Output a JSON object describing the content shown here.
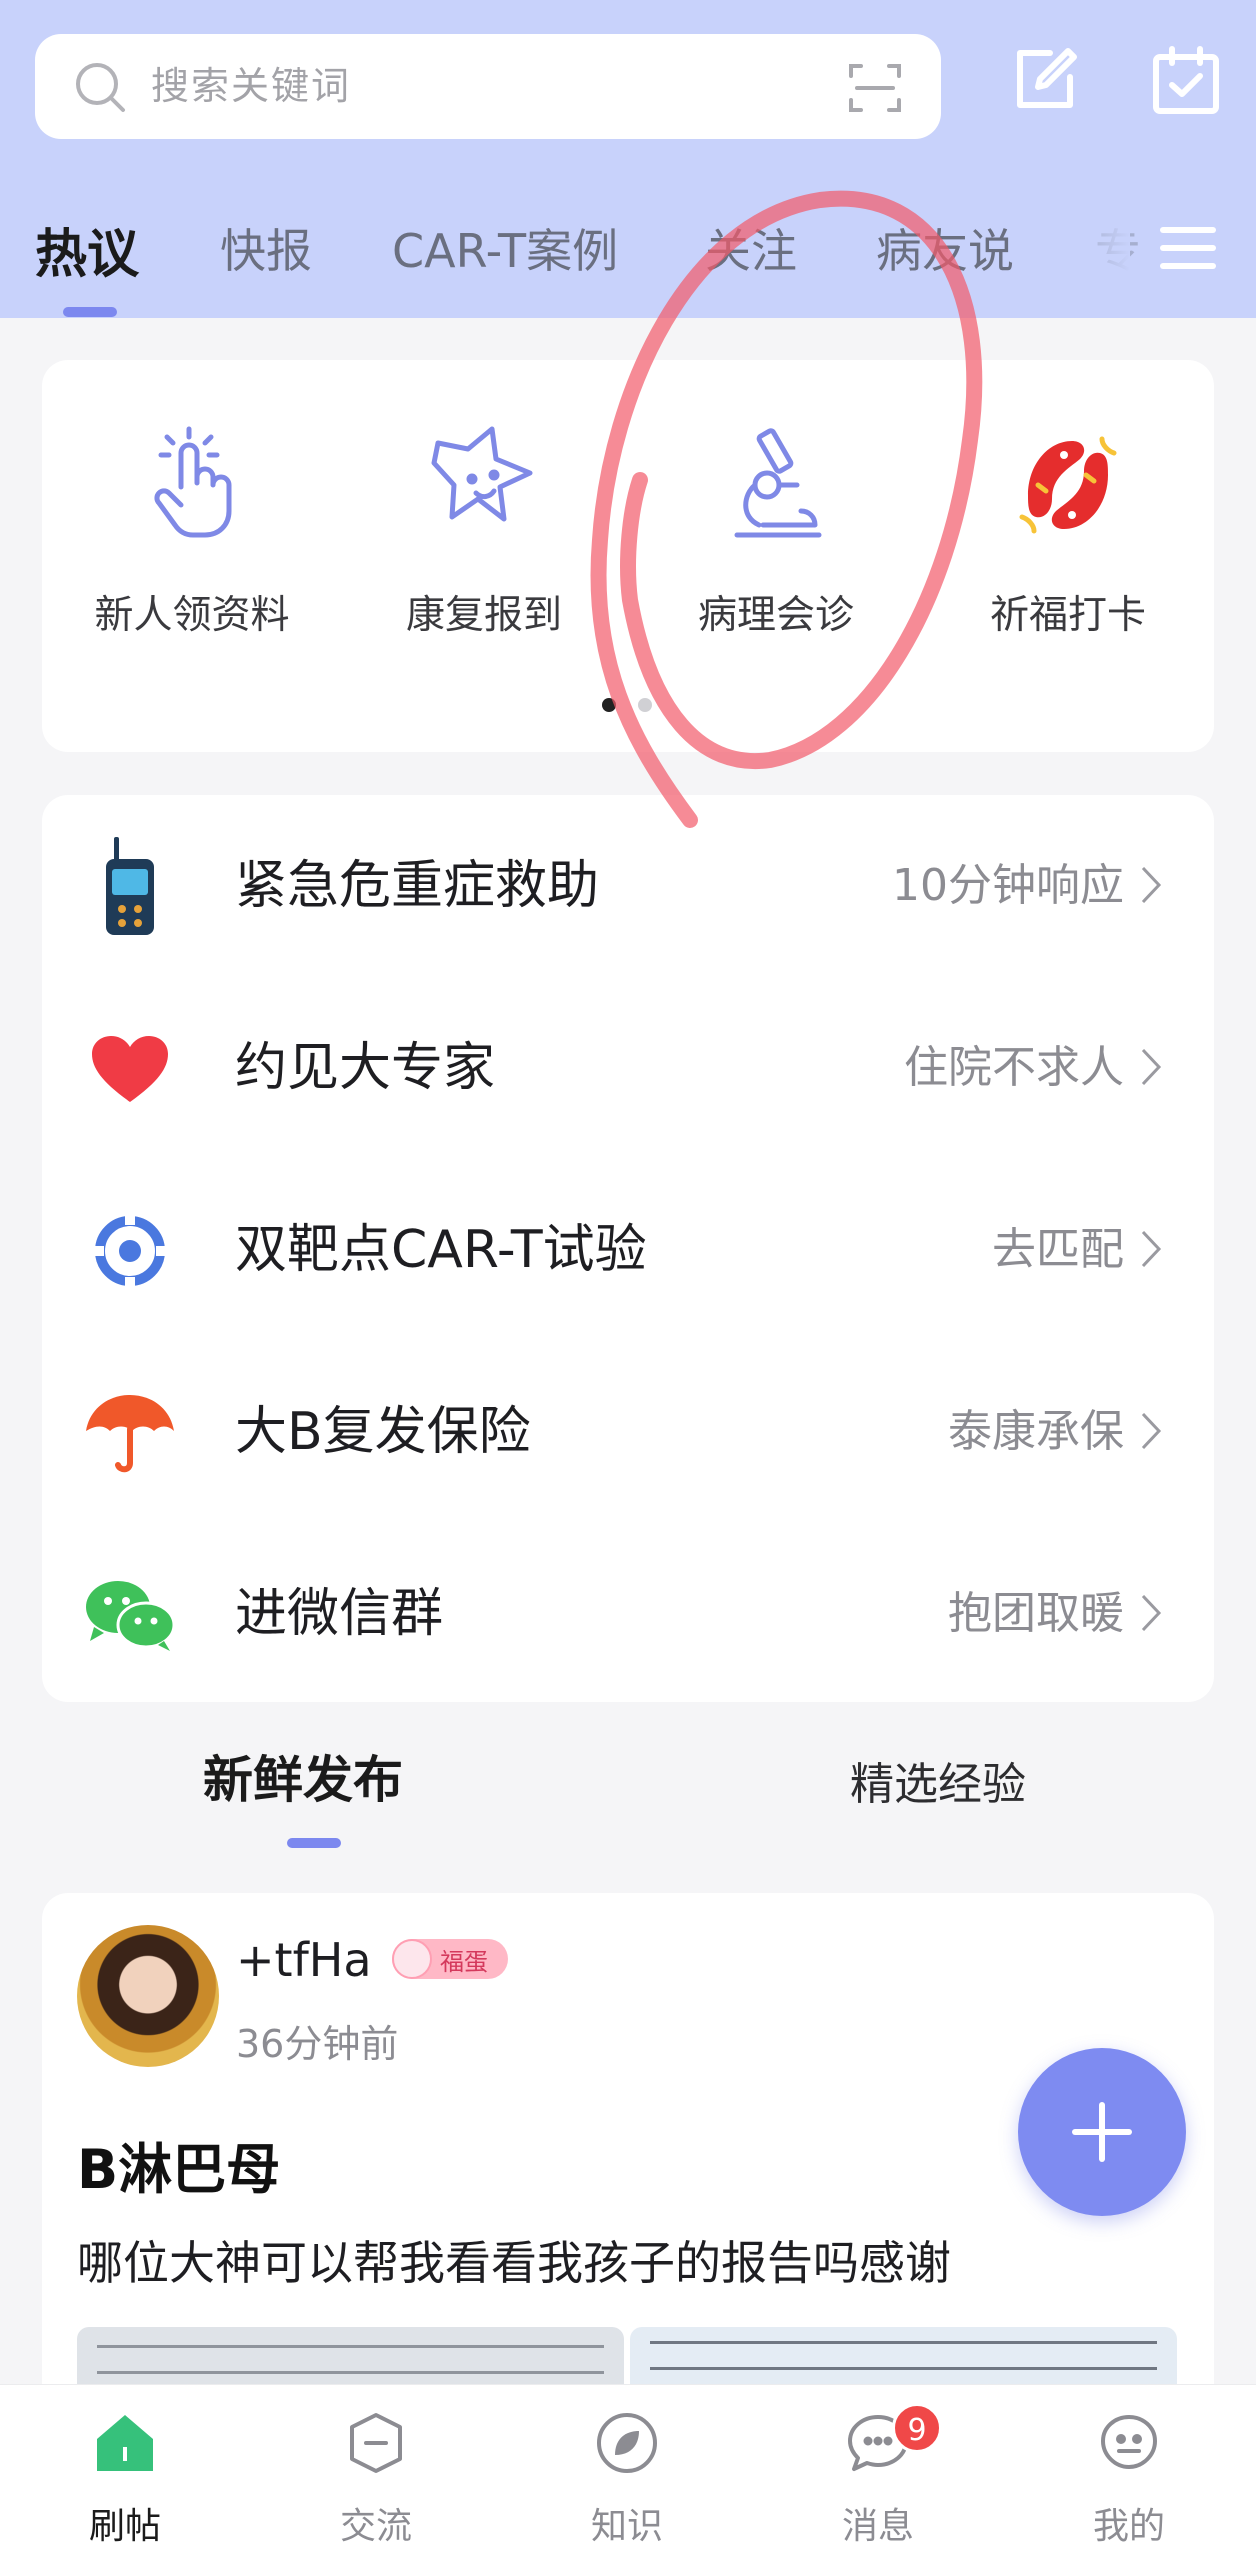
{
  "search": {
    "placeholder": "搜索关键词"
  },
  "tabs": [
    {
      "label": "热议"
    },
    {
      "label": "快报"
    },
    {
      "label": "CAR-T案例"
    },
    {
      "label": "关注"
    },
    {
      "label": "病友说"
    },
    {
      "label": "专"
    }
  ],
  "quick_actions": [
    {
      "label": "新人领资料",
      "icon": "tap-hand-icon"
    },
    {
      "label": "康复报到",
      "icon": "star-face-icon"
    },
    {
      "label": "病理会诊",
      "icon": "microscope-icon"
    },
    {
      "label": "祈福打卡",
      "icon": "koi-fish-icon"
    }
  ],
  "services": [
    {
      "title": "紧急危重症救助",
      "hint": "10分钟响应",
      "icon": "walkie-talkie-icon"
    },
    {
      "title": "约见大专家",
      "hint": "住院不求人",
      "icon": "heart-icon"
    },
    {
      "title": "双靶点CAR-T试验",
      "hint": "去匹配",
      "icon": "target-icon"
    },
    {
      "title": "大B复发保险",
      "hint": "泰康承保",
      "icon": "umbrella-icon"
    },
    {
      "title": "进微信群",
      "hint": "抱团取暖",
      "icon": "wechat-icon"
    }
  ],
  "feed_tabs": [
    {
      "label": "新鲜发布"
    },
    {
      "label": "精选经验"
    }
  ],
  "post": {
    "username": "+tfHa",
    "badge": "福蛋",
    "time": "36分钟前",
    "title": "B淋巴母",
    "body": "哪位大神可以帮我看看我孩子的报告吗感谢"
  },
  "bottom_nav": [
    {
      "label": "刷帖",
      "icon": "home-icon"
    },
    {
      "label": "交流",
      "icon": "minus-hexagon-icon"
    },
    {
      "label": "知识",
      "icon": "leaf-circle-icon"
    },
    {
      "label": "消息",
      "icon": "chat-bubble-icon",
      "badge": "9"
    },
    {
      "label": "我的",
      "icon": "face-icon"
    }
  ],
  "colors": {
    "header_bg": "#c8d2fb",
    "accent": "#7c88ef",
    "fab": "#7e8bf1",
    "active_nav": "#36c17b",
    "badge_red": "#f04848",
    "annotation": "#f25a6a"
  }
}
